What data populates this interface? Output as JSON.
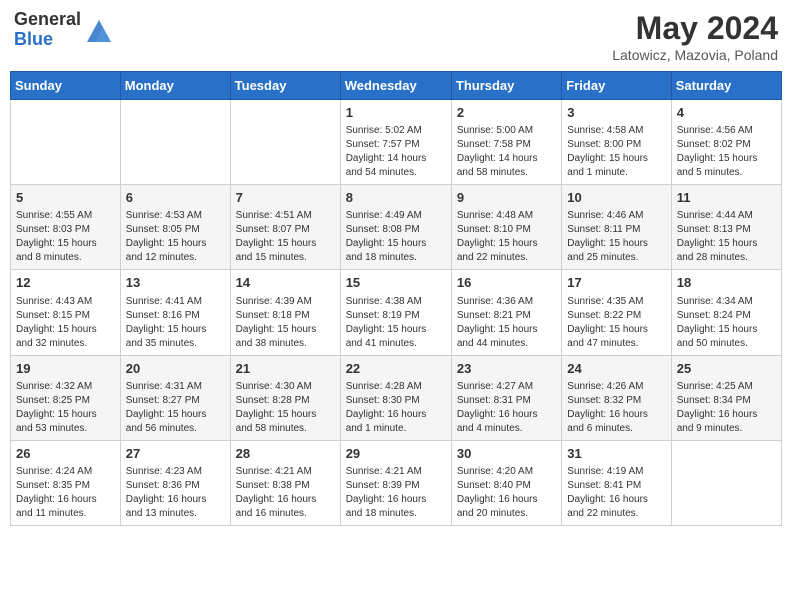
{
  "header": {
    "logo_general": "General",
    "logo_blue": "Blue",
    "main_title": "May 2024",
    "subtitle": "Latowicz, Mazovia, Poland"
  },
  "days_of_week": [
    "Sunday",
    "Monday",
    "Tuesday",
    "Wednesday",
    "Thursday",
    "Friday",
    "Saturday"
  ],
  "weeks": [
    [
      {
        "day": "",
        "info": ""
      },
      {
        "day": "",
        "info": ""
      },
      {
        "day": "",
        "info": ""
      },
      {
        "day": "1",
        "info": "Sunrise: 5:02 AM\nSunset: 7:57 PM\nDaylight: 14 hours\nand 54 minutes."
      },
      {
        "day": "2",
        "info": "Sunrise: 5:00 AM\nSunset: 7:58 PM\nDaylight: 14 hours\nand 58 minutes."
      },
      {
        "day": "3",
        "info": "Sunrise: 4:58 AM\nSunset: 8:00 PM\nDaylight: 15 hours\nand 1 minute."
      },
      {
        "day": "4",
        "info": "Sunrise: 4:56 AM\nSunset: 8:02 PM\nDaylight: 15 hours\nand 5 minutes."
      }
    ],
    [
      {
        "day": "5",
        "info": "Sunrise: 4:55 AM\nSunset: 8:03 PM\nDaylight: 15 hours\nand 8 minutes."
      },
      {
        "day": "6",
        "info": "Sunrise: 4:53 AM\nSunset: 8:05 PM\nDaylight: 15 hours\nand 12 minutes."
      },
      {
        "day": "7",
        "info": "Sunrise: 4:51 AM\nSunset: 8:07 PM\nDaylight: 15 hours\nand 15 minutes."
      },
      {
        "day": "8",
        "info": "Sunrise: 4:49 AM\nSunset: 8:08 PM\nDaylight: 15 hours\nand 18 minutes."
      },
      {
        "day": "9",
        "info": "Sunrise: 4:48 AM\nSunset: 8:10 PM\nDaylight: 15 hours\nand 22 minutes."
      },
      {
        "day": "10",
        "info": "Sunrise: 4:46 AM\nSunset: 8:11 PM\nDaylight: 15 hours\nand 25 minutes."
      },
      {
        "day": "11",
        "info": "Sunrise: 4:44 AM\nSunset: 8:13 PM\nDaylight: 15 hours\nand 28 minutes."
      }
    ],
    [
      {
        "day": "12",
        "info": "Sunrise: 4:43 AM\nSunset: 8:15 PM\nDaylight: 15 hours\nand 32 minutes."
      },
      {
        "day": "13",
        "info": "Sunrise: 4:41 AM\nSunset: 8:16 PM\nDaylight: 15 hours\nand 35 minutes."
      },
      {
        "day": "14",
        "info": "Sunrise: 4:39 AM\nSunset: 8:18 PM\nDaylight: 15 hours\nand 38 minutes."
      },
      {
        "day": "15",
        "info": "Sunrise: 4:38 AM\nSunset: 8:19 PM\nDaylight: 15 hours\nand 41 minutes."
      },
      {
        "day": "16",
        "info": "Sunrise: 4:36 AM\nSunset: 8:21 PM\nDaylight: 15 hours\nand 44 minutes."
      },
      {
        "day": "17",
        "info": "Sunrise: 4:35 AM\nSunset: 8:22 PM\nDaylight: 15 hours\nand 47 minutes."
      },
      {
        "day": "18",
        "info": "Sunrise: 4:34 AM\nSunset: 8:24 PM\nDaylight: 15 hours\nand 50 minutes."
      }
    ],
    [
      {
        "day": "19",
        "info": "Sunrise: 4:32 AM\nSunset: 8:25 PM\nDaylight: 15 hours\nand 53 minutes."
      },
      {
        "day": "20",
        "info": "Sunrise: 4:31 AM\nSunset: 8:27 PM\nDaylight: 15 hours\nand 56 minutes."
      },
      {
        "day": "21",
        "info": "Sunrise: 4:30 AM\nSunset: 8:28 PM\nDaylight: 15 hours\nand 58 minutes."
      },
      {
        "day": "22",
        "info": "Sunrise: 4:28 AM\nSunset: 8:30 PM\nDaylight: 16 hours\nand 1 minute."
      },
      {
        "day": "23",
        "info": "Sunrise: 4:27 AM\nSunset: 8:31 PM\nDaylight: 16 hours\nand 4 minutes."
      },
      {
        "day": "24",
        "info": "Sunrise: 4:26 AM\nSunset: 8:32 PM\nDaylight: 16 hours\nand 6 minutes."
      },
      {
        "day": "25",
        "info": "Sunrise: 4:25 AM\nSunset: 8:34 PM\nDaylight: 16 hours\nand 9 minutes."
      }
    ],
    [
      {
        "day": "26",
        "info": "Sunrise: 4:24 AM\nSunset: 8:35 PM\nDaylight: 16 hours\nand 11 minutes."
      },
      {
        "day": "27",
        "info": "Sunrise: 4:23 AM\nSunset: 8:36 PM\nDaylight: 16 hours\nand 13 minutes."
      },
      {
        "day": "28",
        "info": "Sunrise: 4:21 AM\nSunset: 8:38 PM\nDaylight: 16 hours\nand 16 minutes."
      },
      {
        "day": "29",
        "info": "Sunrise: 4:21 AM\nSunset: 8:39 PM\nDaylight: 16 hours\nand 18 minutes."
      },
      {
        "day": "30",
        "info": "Sunrise: 4:20 AM\nSunset: 8:40 PM\nDaylight: 16 hours\nand 20 minutes."
      },
      {
        "day": "31",
        "info": "Sunrise: 4:19 AM\nSunset: 8:41 PM\nDaylight: 16 hours\nand 22 minutes."
      },
      {
        "day": "",
        "info": ""
      }
    ]
  ]
}
